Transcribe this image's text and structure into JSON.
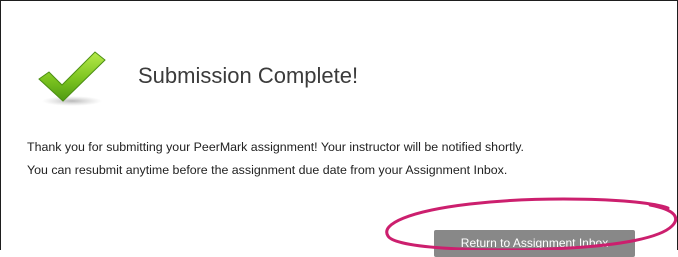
{
  "dialog": {
    "title": "Submission Complete!",
    "status_icon": "checkmark-icon",
    "message_lines": [
      "Thank you for submitting your PeerMark assignment! Your instructor will be notified shortly.",
      "You can resubmit anytime before the assignment due date from your Assignment Inbox."
    ],
    "return_button_label": "Return to Assignment Inbox"
  },
  "colors": {
    "check_green": "#7cc420",
    "button_bg": "#888888",
    "annotation_oval": "#cc1f6e",
    "border": "#1e1e1e"
  }
}
